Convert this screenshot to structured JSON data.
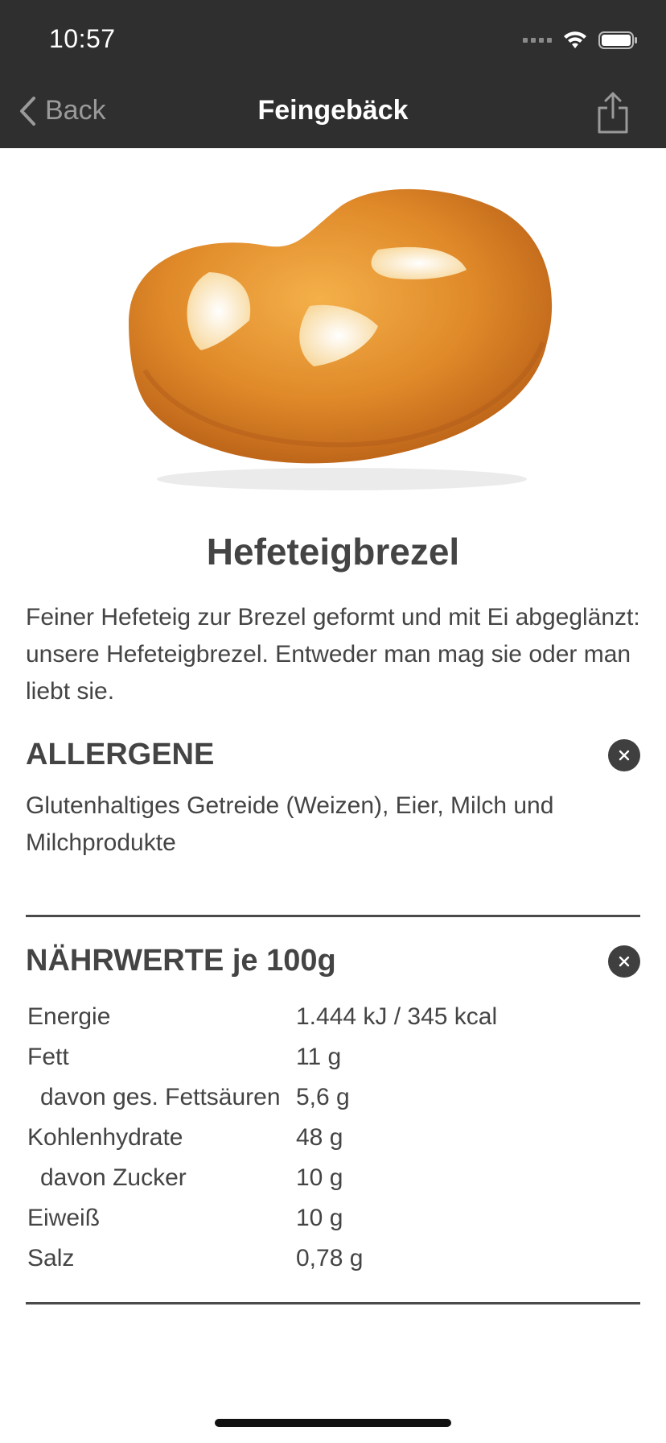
{
  "status_bar": {
    "time": "10:57"
  },
  "nav": {
    "back_label": "Back",
    "title": "Feingebäck"
  },
  "product": {
    "title": "Hefeteigbrezel",
    "description": "Feiner Hefeteig zur Brezel geformt und mit Ei abgeglänzt: unsere Hefeteigbrezel. Entweder man mag sie oder man liebt sie."
  },
  "allergens": {
    "heading": "ALLERGENE",
    "text": "Glutenhaltiges Getreide (Weizen), Eier, Milch und Milchprodukte"
  },
  "nutrition": {
    "heading": "NÄHRWERTE je 100g",
    "rows": [
      {
        "name": "Energie",
        "value": "1.444 kJ / 345 kcal"
      },
      {
        "name": "Fett",
        "value": "11 g"
      },
      {
        "name": "davon ges. Fettsäuren",
        "value": "5,6 g"
      },
      {
        "name": "Kohlenhydrate",
        "value": "48 g"
      },
      {
        "name": "davon Zucker",
        "value": "10 g"
      },
      {
        "name": "Eiweiß",
        "value": "10 g"
      },
      {
        "name": "Salz",
        "value": "0,78 g"
      }
    ]
  },
  "colors": {
    "bar": "#2f2f2f",
    "text": "#444444",
    "accent_bread": "#e08a2a"
  },
  "icons": [
    "chevron-left-icon",
    "share-icon",
    "close-icon",
    "wifi-icon",
    "battery-icon",
    "signal-icon"
  ]
}
